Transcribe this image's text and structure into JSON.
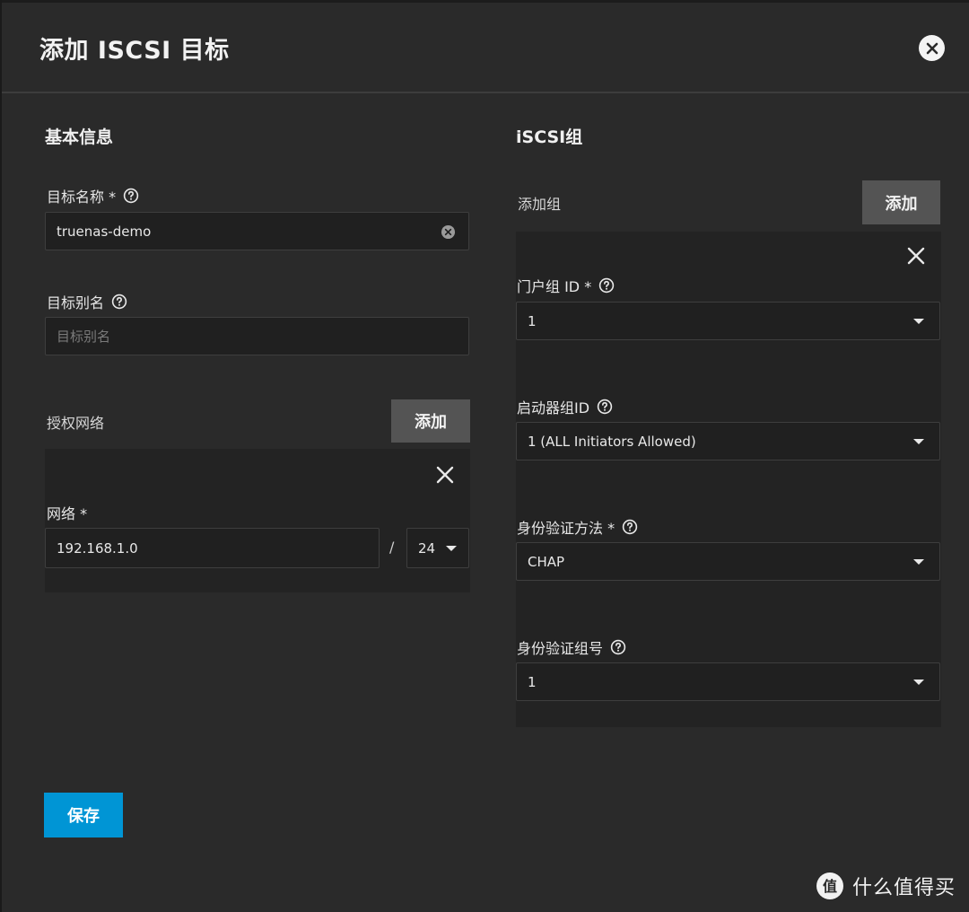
{
  "dialog": {
    "title": "添加 ISCSI 目标",
    "close_icon": "close-circle-icon"
  },
  "basic_info": {
    "section_title": "基本信息",
    "target_name": {
      "label": "目标名称 *",
      "value": "truenas-demo"
    },
    "target_alias": {
      "label": "目标别名",
      "value": "",
      "placeholder": "目标别名"
    },
    "authorized_networks": {
      "label": "授权网络",
      "add_label": "添加",
      "network": {
        "label": "网络 *",
        "ip": "192.168.1.0",
        "separator": "/",
        "mask": "24"
      }
    }
  },
  "iscsi_group": {
    "section_title": "iSCSI组",
    "add_group_label": "添加组",
    "add_label": "添加",
    "portal_group": {
      "label": "门户组 ID *",
      "value": "1"
    },
    "initiator_group": {
      "label": "启动器组ID",
      "value": "1 (ALL Initiators Allowed)"
    },
    "auth_method": {
      "label": "身份验证方法 *",
      "value": "CHAP"
    },
    "auth_group": {
      "label": "身份验证组号",
      "value": "1"
    }
  },
  "footer": {
    "save_label": "保存"
  },
  "watermark": {
    "text": "什么值得买",
    "logo_char": "值"
  },
  "colors": {
    "background": "#2a2a2a",
    "primary": "#0095d5",
    "secondary_button": "#545454"
  }
}
